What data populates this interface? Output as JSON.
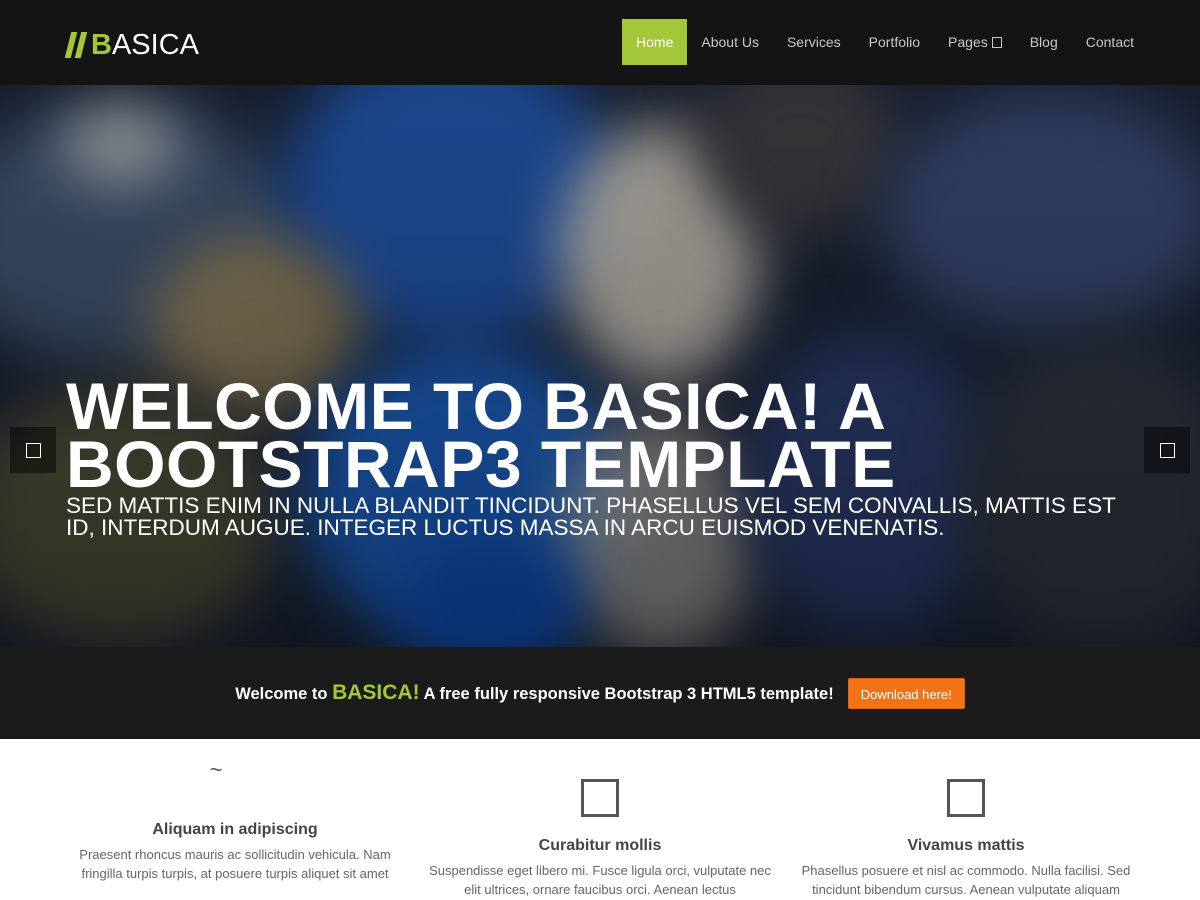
{
  "header": {
    "logo_first": "B",
    "logo_rest": "ASICA",
    "nav": [
      {
        "label": "Home",
        "active": true
      },
      {
        "label": "About Us"
      },
      {
        "label": "Services"
      },
      {
        "label": "Portfolio"
      },
      {
        "label": "Pages"
      },
      {
        "label": "Blog"
      },
      {
        "label": "Contact"
      }
    ]
  },
  "hero": {
    "title": "Welcome to Basica! A Bootstrap3 Template",
    "subtitle": "Sed mattis enim in nulla blandit tincidunt. Phasellus vel sem convallis, mattis est id, interdum augue. Integer luctus massa in arcu euismod venenatis.",
    "active_slide": 1,
    "slide_count": 3
  },
  "welcome": {
    "prefix": "Welcome to",
    "brand": "BASICA!",
    "suffix": "A free fully responsive Bootstrap 3 HTML5 template!",
    "button": "Download here!"
  },
  "features": [
    {
      "icon": "wave-icon",
      "title": "Aliquam in adipiscing",
      "text": "Praesent rhoncus mauris ac sollicitudin vehicula. Nam fringilla turpis turpis, at posuere turpis aliquet sit amet"
    },
    {
      "icon": "square-icon",
      "title": "Curabitur mollis",
      "text": "Suspendisse eget libero mi. Fusce ligula orci, vulputate nec elit ultrices, ornare faucibus orci. Aenean lectus"
    },
    {
      "icon": "square-icon",
      "title": "Vivamus mattis",
      "text": "Phasellus posuere et nisl ac commodo. Nulla facilisi. Sed tincidunt bibendum cursus. Aenean vulputate aliquam"
    }
  ],
  "colors": {
    "accent": "#a4c639",
    "header_bg": "#141414",
    "download_button": "#f47216",
    "welcome_bar_bg": "#1b1b1b"
  }
}
